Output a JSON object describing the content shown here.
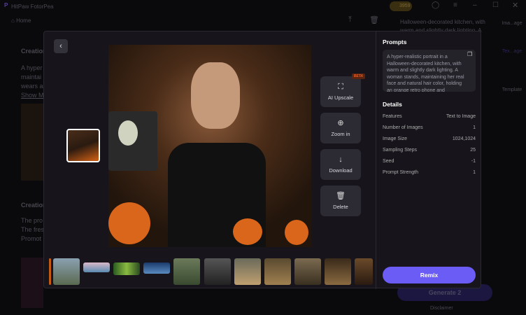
{
  "app": {
    "title": "HitPaw FotorPea",
    "credits": "3959",
    "home": "Home"
  },
  "background": {
    "creation1_title": "Creation",
    "creation1_text": [
      "A hyper",
      "maintai",
      "wears a"
    ],
    "show_more": "Show M",
    "creation2_title": "Creation",
    "creation2_text": [
      "The pro",
      "The fres",
      "Promot"
    ],
    "side_prompt": [
      "Halloween-decorated kitchen, with",
      "warm and slightly dark lighting. A"
    ],
    "sidebar": [
      "Ima...age",
      "Tex...age",
      "Template"
    ],
    "generate": "Generate",
    "generate_cost": "2",
    "disclaimer": "Disclaimer"
  },
  "modal": {
    "actions": [
      {
        "label": "AI Upscale",
        "icon": "upscale-icon",
        "badge": "BETA"
      },
      {
        "label": "Zoom in",
        "icon": "zoom-in-icon"
      },
      {
        "label": "Download",
        "icon": "download-icon"
      },
      {
        "label": "Delete",
        "icon": "trash-icon"
      }
    ],
    "prompts_title": "Prompts",
    "prompt": "A hyper-realistic portrait in a Halloween-decorated kitchen, with warm and slightly dark lighting. A woman stands, maintaining her real face and natural hair color, holding an orange retro phone and",
    "details_title": "Details",
    "details": [
      {
        "label": "Features",
        "value": "Text to Image"
      },
      {
        "label": "Number of Images",
        "value": "1"
      },
      {
        "label": "Image Size",
        "value": "1024,1024"
      },
      {
        "label": "Sampling Steps",
        "value": "25"
      },
      {
        "label": "Seed",
        "value": "-1"
      },
      {
        "label": "Prompt Strength",
        "value": "1"
      }
    ],
    "remix": "Remix"
  },
  "colors": {
    "accent": "#6c5cf6",
    "beta": "#e0612a"
  }
}
